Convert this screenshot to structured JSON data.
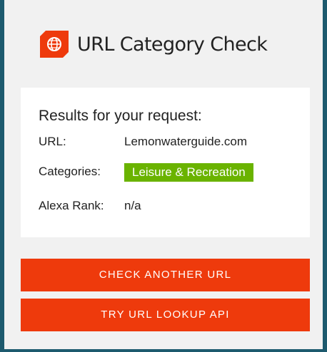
{
  "app": {
    "title": "URL Category Check",
    "logo_icon": "globe-shield-icon",
    "brand_color": "#ee3a0c"
  },
  "results": {
    "heading": "Results for your request:",
    "url_label": "URL:",
    "url_value": "Lemonwaterguide.com",
    "categories_label": "Categories:",
    "category_badge": "Leisure & Recreation",
    "category_color": "#6ab300",
    "alexa_label": "Alexa Rank:",
    "alexa_value": "n/a"
  },
  "actions": {
    "check_another_label": "CHECK ANOTHER URL",
    "lookup_api_label": "TRY URL LOOKUP API"
  }
}
